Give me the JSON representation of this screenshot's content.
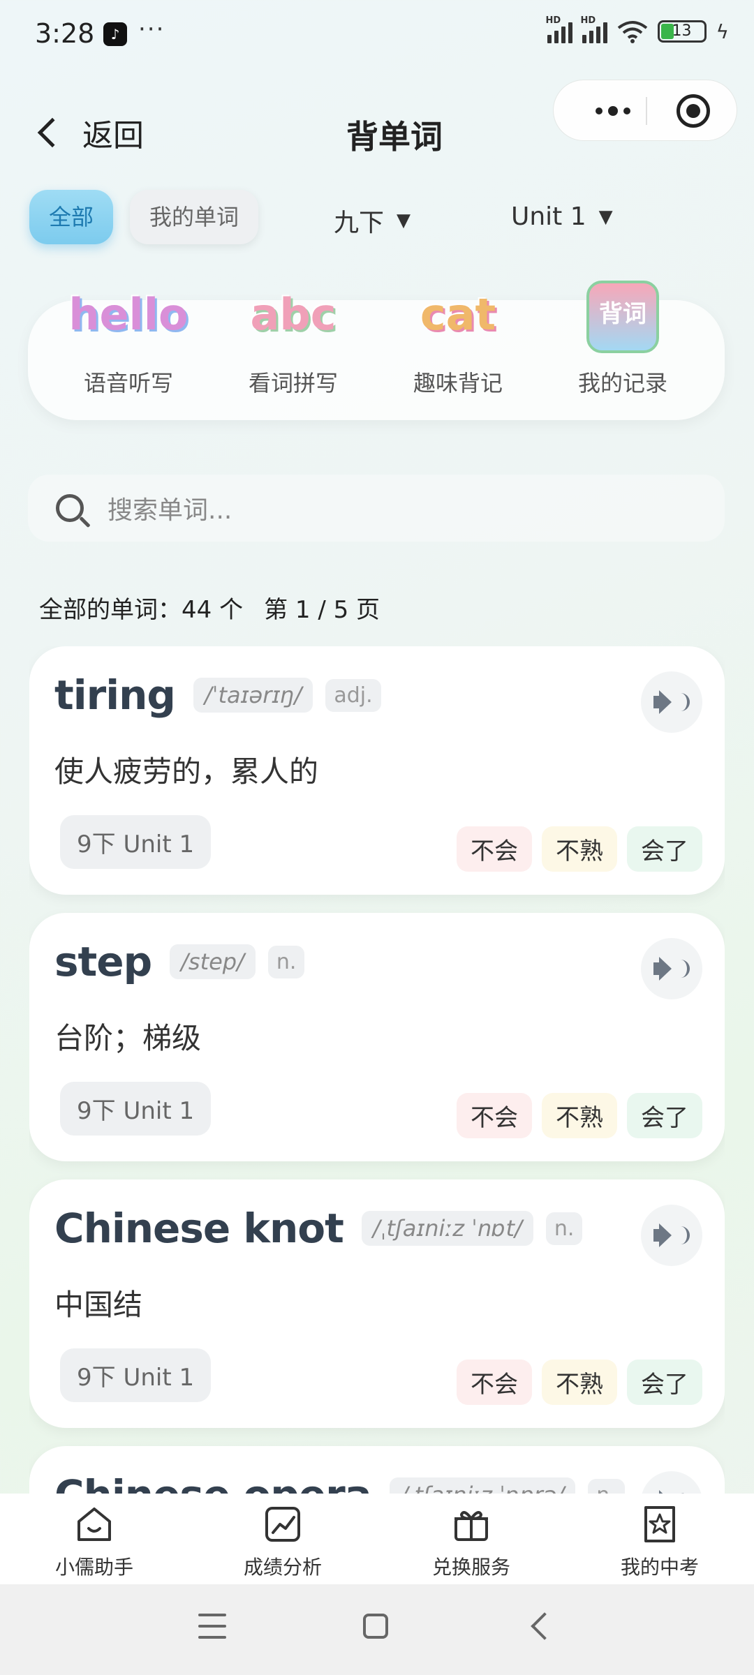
{
  "status_bar": {
    "time": "3:28",
    "more": "···",
    "battery": "13",
    "app_icon": "tiktok-icon"
  },
  "nav": {
    "back_label": "返回",
    "title": "背单词"
  },
  "tabs": {
    "all": "全部",
    "mine": "我的单词"
  },
  "filters": {
    "grade": "九下",
    "unit": "Unit 1",
    "arrow": "▼"
  },
  "modes": [
    {
      "art": "hello",
      "label": "语音听写"
    },
    {
      "art": "abc",
      "label": "看词拼写"
    },
    {
      "art": "cat",
      "label": "趣味背记"
    },
    {
      "art": "背词",
      "label": "我的记录"
    }
  ],
  "search": {
    "placeholder": "搜索单词..."
  },
  "summary": {
    "count_text": "全部的单词：44 个",
    "page_text": "第 1 / 5 页"
  },
  "words": [
    {
      "word": "tiring",
      "phonetic": "/ˈtaɪərɪŋ/",
      "pos": "adj.",
      "meaning": "使人疲劳的，累人的",
      "unit": "9下 Unit 1"
    },
    {
      "word": "step",
      "phonetic": "/step/",
      "pos": "n.",
      "meaning": "台阶；梯级",
      "unit": "9下 Unit 1"
    },
    {
      "word": "Chinese knot",
      "phonetic": "/ˌtʃaɪniːz ˈnɒt/",
      "pos": "n.",
      "meaning": "中国结",
      "unit": "9下 Unit 1"
    },
    {
      "word": "Chinese opera",
      "phonetic": "/ˌtʃaɪniːz ˈɒprə/",
      "pos": "n.",
      "meaning": "",
      "unit": ""
    }
  ],
  "status_labels": {
    "no": "不会",
    "shaky": "不熟",
    "yes": "会了"
  },
  "tabbar": [
    {
      "label": "小儒助手",
      "icon": "home-icon"
    },
    {
      "label": "成绩分析",
      "icon": "chart-icon"
    },
    {
      "label": "兑换服务",
      "icon": "gift-icon"
    },
    {
      "label": "我的中考",
      "icon": "star-doc-icon"
    }
  ],
  "colors": {
    "accent": "#7ccbee",
    "no": "#fdeeee",
    "shaky": "#fdf8e6",
    "yes": "#e9f7ef"
  }
}
